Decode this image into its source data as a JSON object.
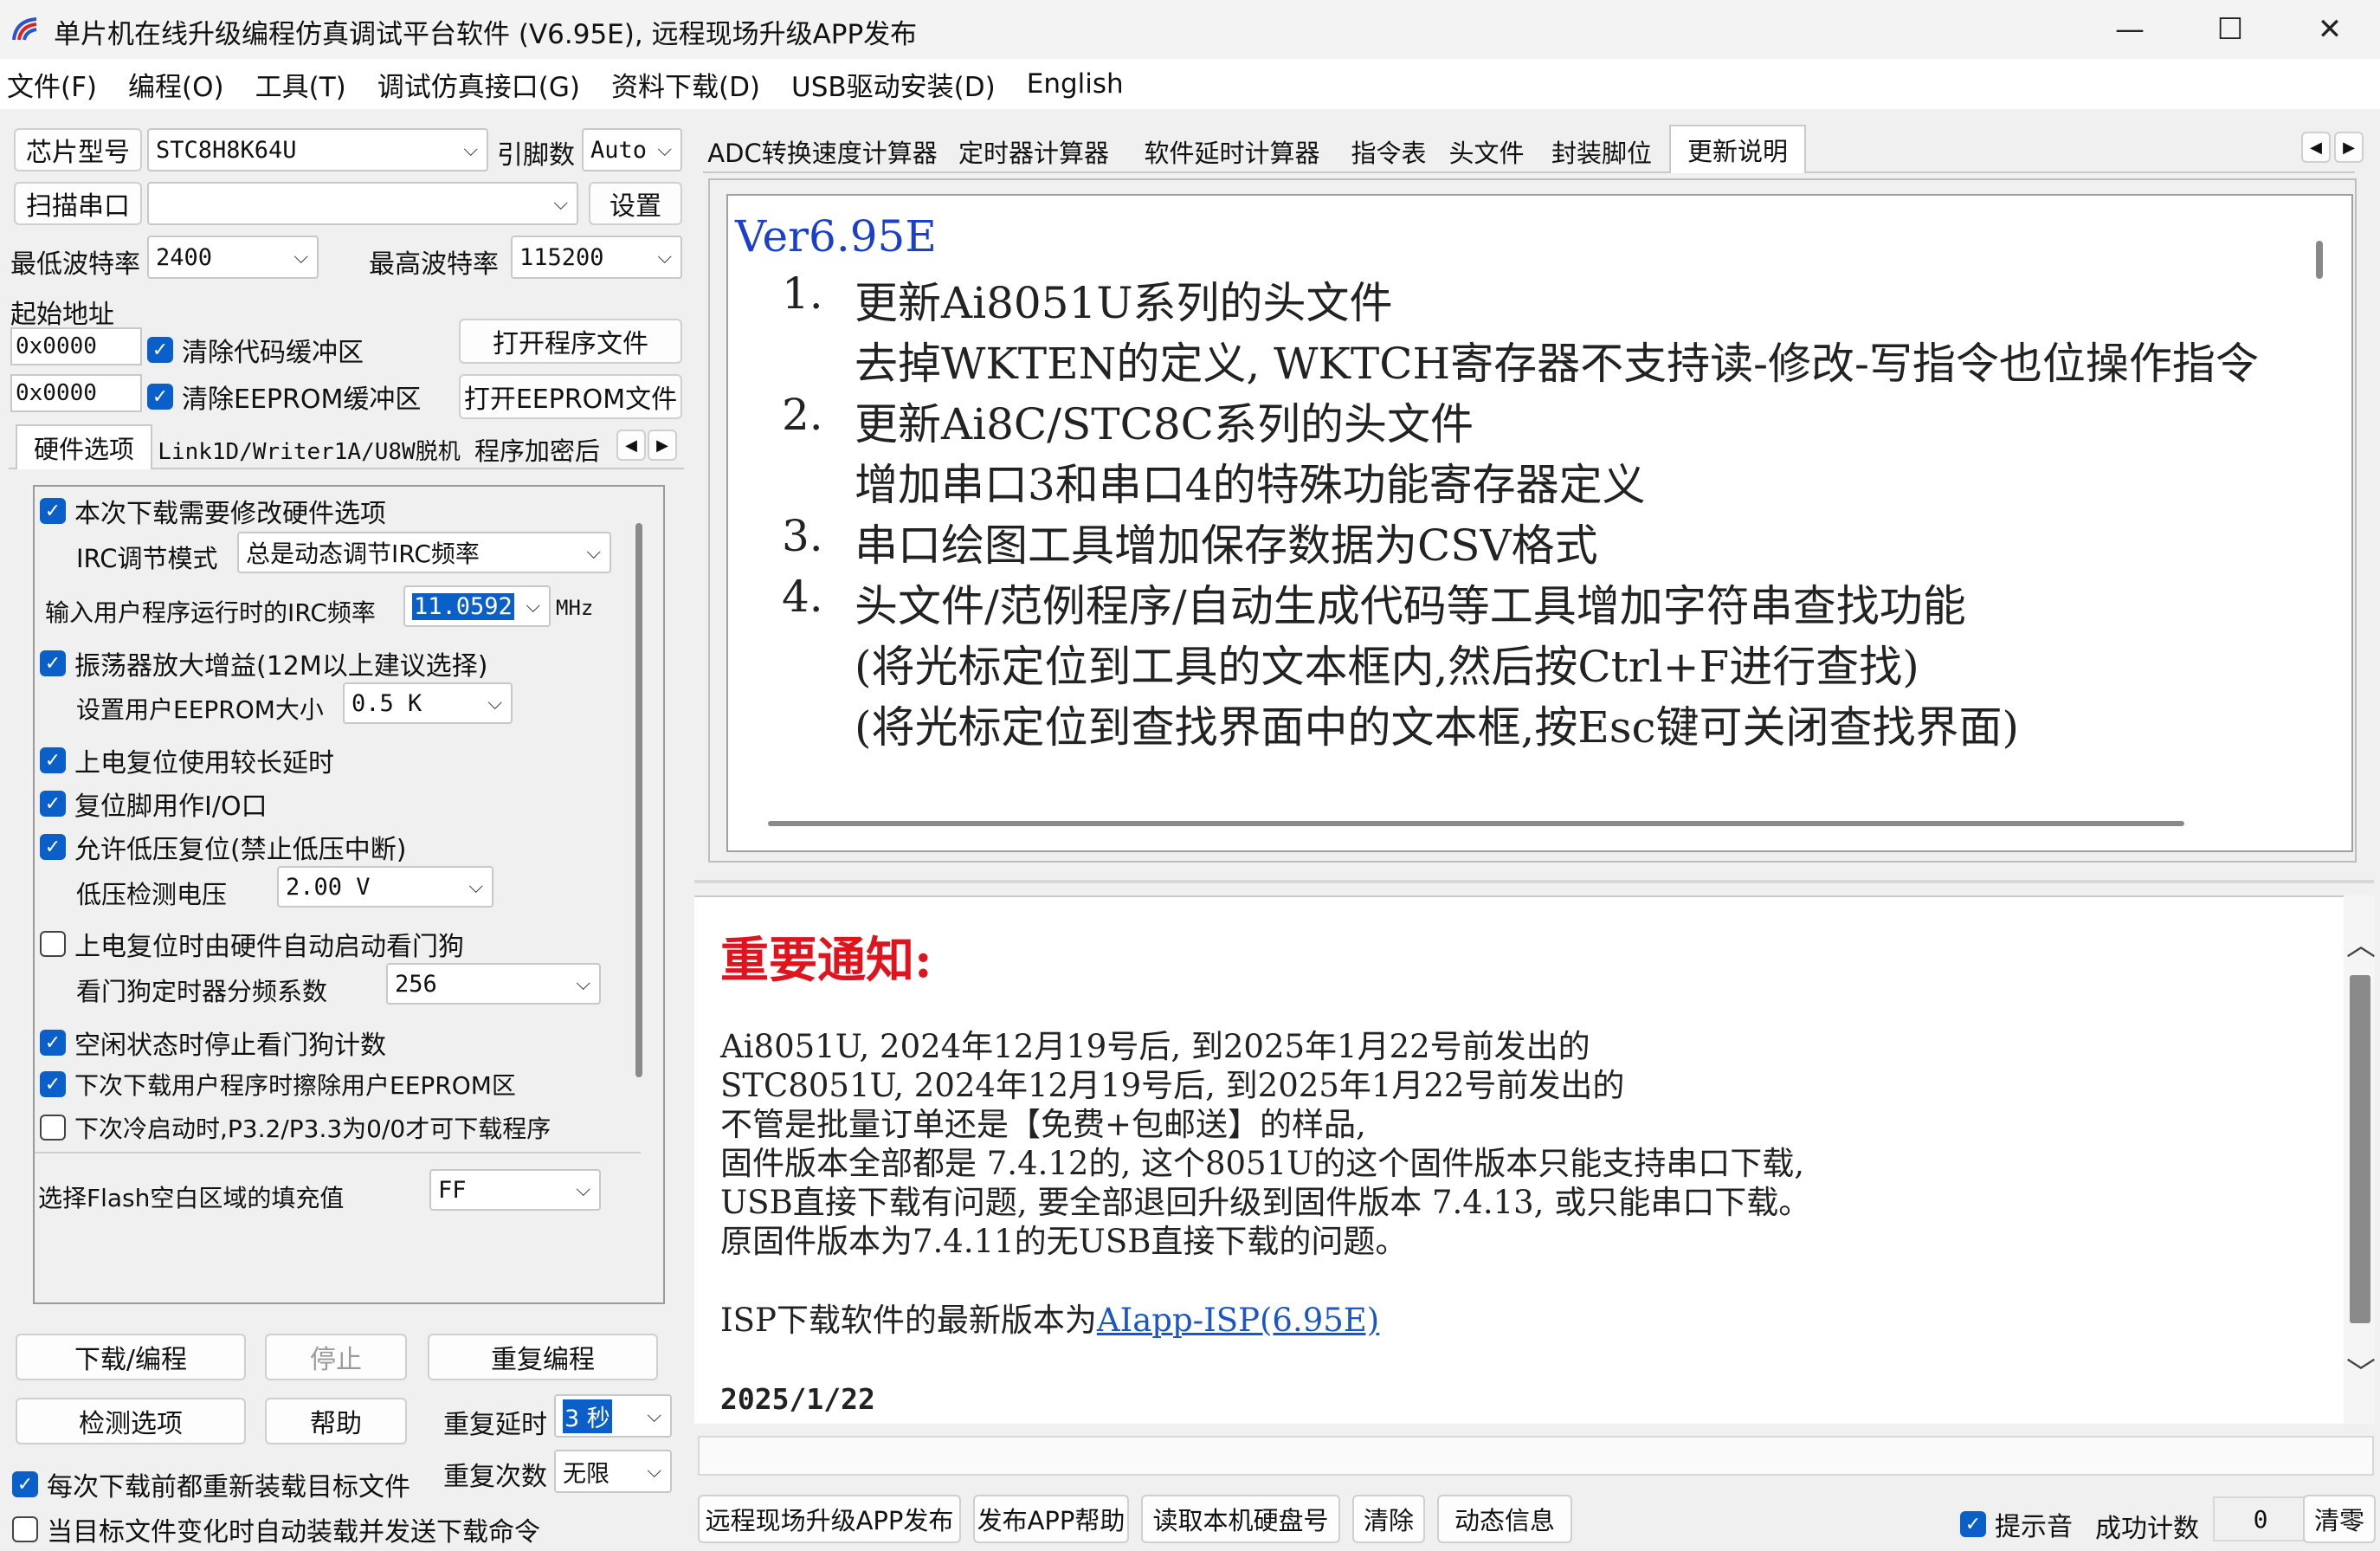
{
  "window": {
    "title": "单片机在线升级编程仿真调试平台软件 (V6.95E), 远程现场升级APP发布",
    "minimize": "—",
    "maximize": "☐",
    "close": "✕"
  },
  "menu": [
    "文件(F)",
    "编程(O)",
    "工具(T)",
    "调试仿真接口(G)",
    "资料下载(D)",
    "USB驱动安装(D)",
    "English"
  ],
  "left": {
    "chip_label": "芯片型号",
    "chip_value": "STC8H8K64U",
    "pins_label": "引脚数",
    "pins_value": "Auto",
    "scan_label": "扫描串口",
    "port_value": "",
    "settings_label": "设置",
    "min_baud_label": "最低波特率",
    "min_baud_value": "2400",
    "max_baud_label": "最高波特率",
    "max_baud_value": "115200",
    "start_addr_label": "起始地址",
    "addr1": "0x0000",
    "addr2": "0x0000",
    "clear_code": "清除代码缓冲区",
    "clear_eeprom": "清除EEPROM缓冲区",
    "open_prog": "打开程序文件",
    "open_eeprom": "打开EEPROM文件",
    "tabs": [
      "硬件选项",
      "Link1D/Writer1A/U8W脱机",
      "程序加密后"
    ],
    "hw": {
      "modify_hw": "本次下载需要修改硬件选项",
      "irc_mode_label": "IRC调节模式",
      "irc_mode_value": "总是动态调节IRC频率",
      "irc_freq_label": "输入用户程序运行时的IRC频率",
      "irc_freq_value": "11.0592",
      "irc_unit": "MHz",
      "osc_gain": "振荡器放大增益(12M以上建议选择)",
      "eeprom_size_label": "设置用户EEPROM大小",
      "eeprom_size_value": "0.5 K",
      "por_delay": "上电复位使用较长延时",
      "reset_io": "复位脚用作I/O口",
      "lvr": "允许低压复位(禁止低压中断)",
      "lvd_label": "低压检测电压",
      "lvd_value": "2.00 V",
      "wdt_auto": "上电复位时由硬件自动启动看门狗",
      "wdt_div_label": "看门狗定时器分频系数",
      "wdt_div_value": "256",
      "wdt_idle": "空闲状态时停止看门狗计数",
      "erase_eeprom": "下次下载用户程序时擦除用户EEPROM区",
      "cold_boot": "下次冷启动时,P3.2/P3.3为0/0才可下载程序",
      "fill_label": "选择Flash空白区域的填充值",
      "fill_value": "FF"
    },
    "download": "下载/编程",
    "stop": "停止",
    "redo": "重复编程",
    "check": "检测选项",
    "help": "帮助",
    "repeat_delay_label": "重复延时",
    "repeat_delay_value": "3 秒",
    "repeat_count_label": "重复次数",
    "repeat_count_value": "无限",
    "reload_before": "每次下载前都重新装载目标文件",
    "auto_reload": "当目标文件变化时自动装载并发送下载命令"
  },
  "right": {
    "tabs": [
      "ADC转换速度计算器",
      "定时器计算器",
      "软件延时计算器",
      "指令表",
      "头文件",
      "封装脚位",
      "更新说明"
    ],
    "version": "Ver6.95E",
    "changes": [
      {
        "num": "1.",
        "text": "更新Ai8051U系列的头文件"
      },
      {
        "num": "",
        "text": "去掉WKTEN的定义, WKTCH寄存器不支持读-修改-写指令也位操作指令"
      },
      {
        "num": "2.",
        "text": "更新Ai8C/STC8C系列的头文件"
      },
      {
        "num": "",
        "text": "增加串口3和串口4的特殊功能寄存器定义"
      },
      {
        "num": "3.",
        "text": "串口绘图工具增加保存数据为CSV格式"
      },
      {
        "num": "4.",
        "text": "头文件/范例程序/自动生成代码等工具增加字符串查找功能"
      },
      {
        "num": "",
        "text": "(将光标定位到工具的文本框内,然后按Ctrl+F进行查找)"
      },
      {
        "num": "",
        "text": "(将光标定位到查找界面中的文本框,按Esc键可关闭查找界面)"
      }
    ],
    "notice_title": "重要通知:",
    "notice_lines": [
      "Ai8051U,  2024年12月19号后, 到2025年1月22号前发出的",
      "STC8051U, 2024年12月19号后, 到2025年1月22号前发出的",
      "不管是批量订单还是【免费+包邮送】的样品,",
      "固件版本全部都是 7.4.12的, 这个8051U的这个固件版本只能支持串口下载,",
      "USB直接下载有问题, 要全部退回升级到固件版本 7.4.13, 或只能串口下载。",
      "原固件版本为7.4.11的无USB直接下载的问题。"
    ],
    "isp_prefix": "ISP下载软件的最新版本为",
    "isp_link": "AIapp-ISP(6.95E)",
    "date": "2025/1/22",
    "bottom": {
      "remote_upgrade": "远程现场升级APP发布",
      "publish_help": "发布APP帮助",
      "read_disk": "读取本机硬盘号",
      "clear": "清除",
      "dyn_info": "动态信息",
      "beep": "提示音",
      "success_label": "成功计数",
      "success_value": "0",
      "reset": "清零"
    }
  },
  "colors": {
    "accent": "#0a5fc8",
    "notice": "#e0141e",
    "link": "#1a56c8",
    "version": "#1a3fcc"
  }
}
